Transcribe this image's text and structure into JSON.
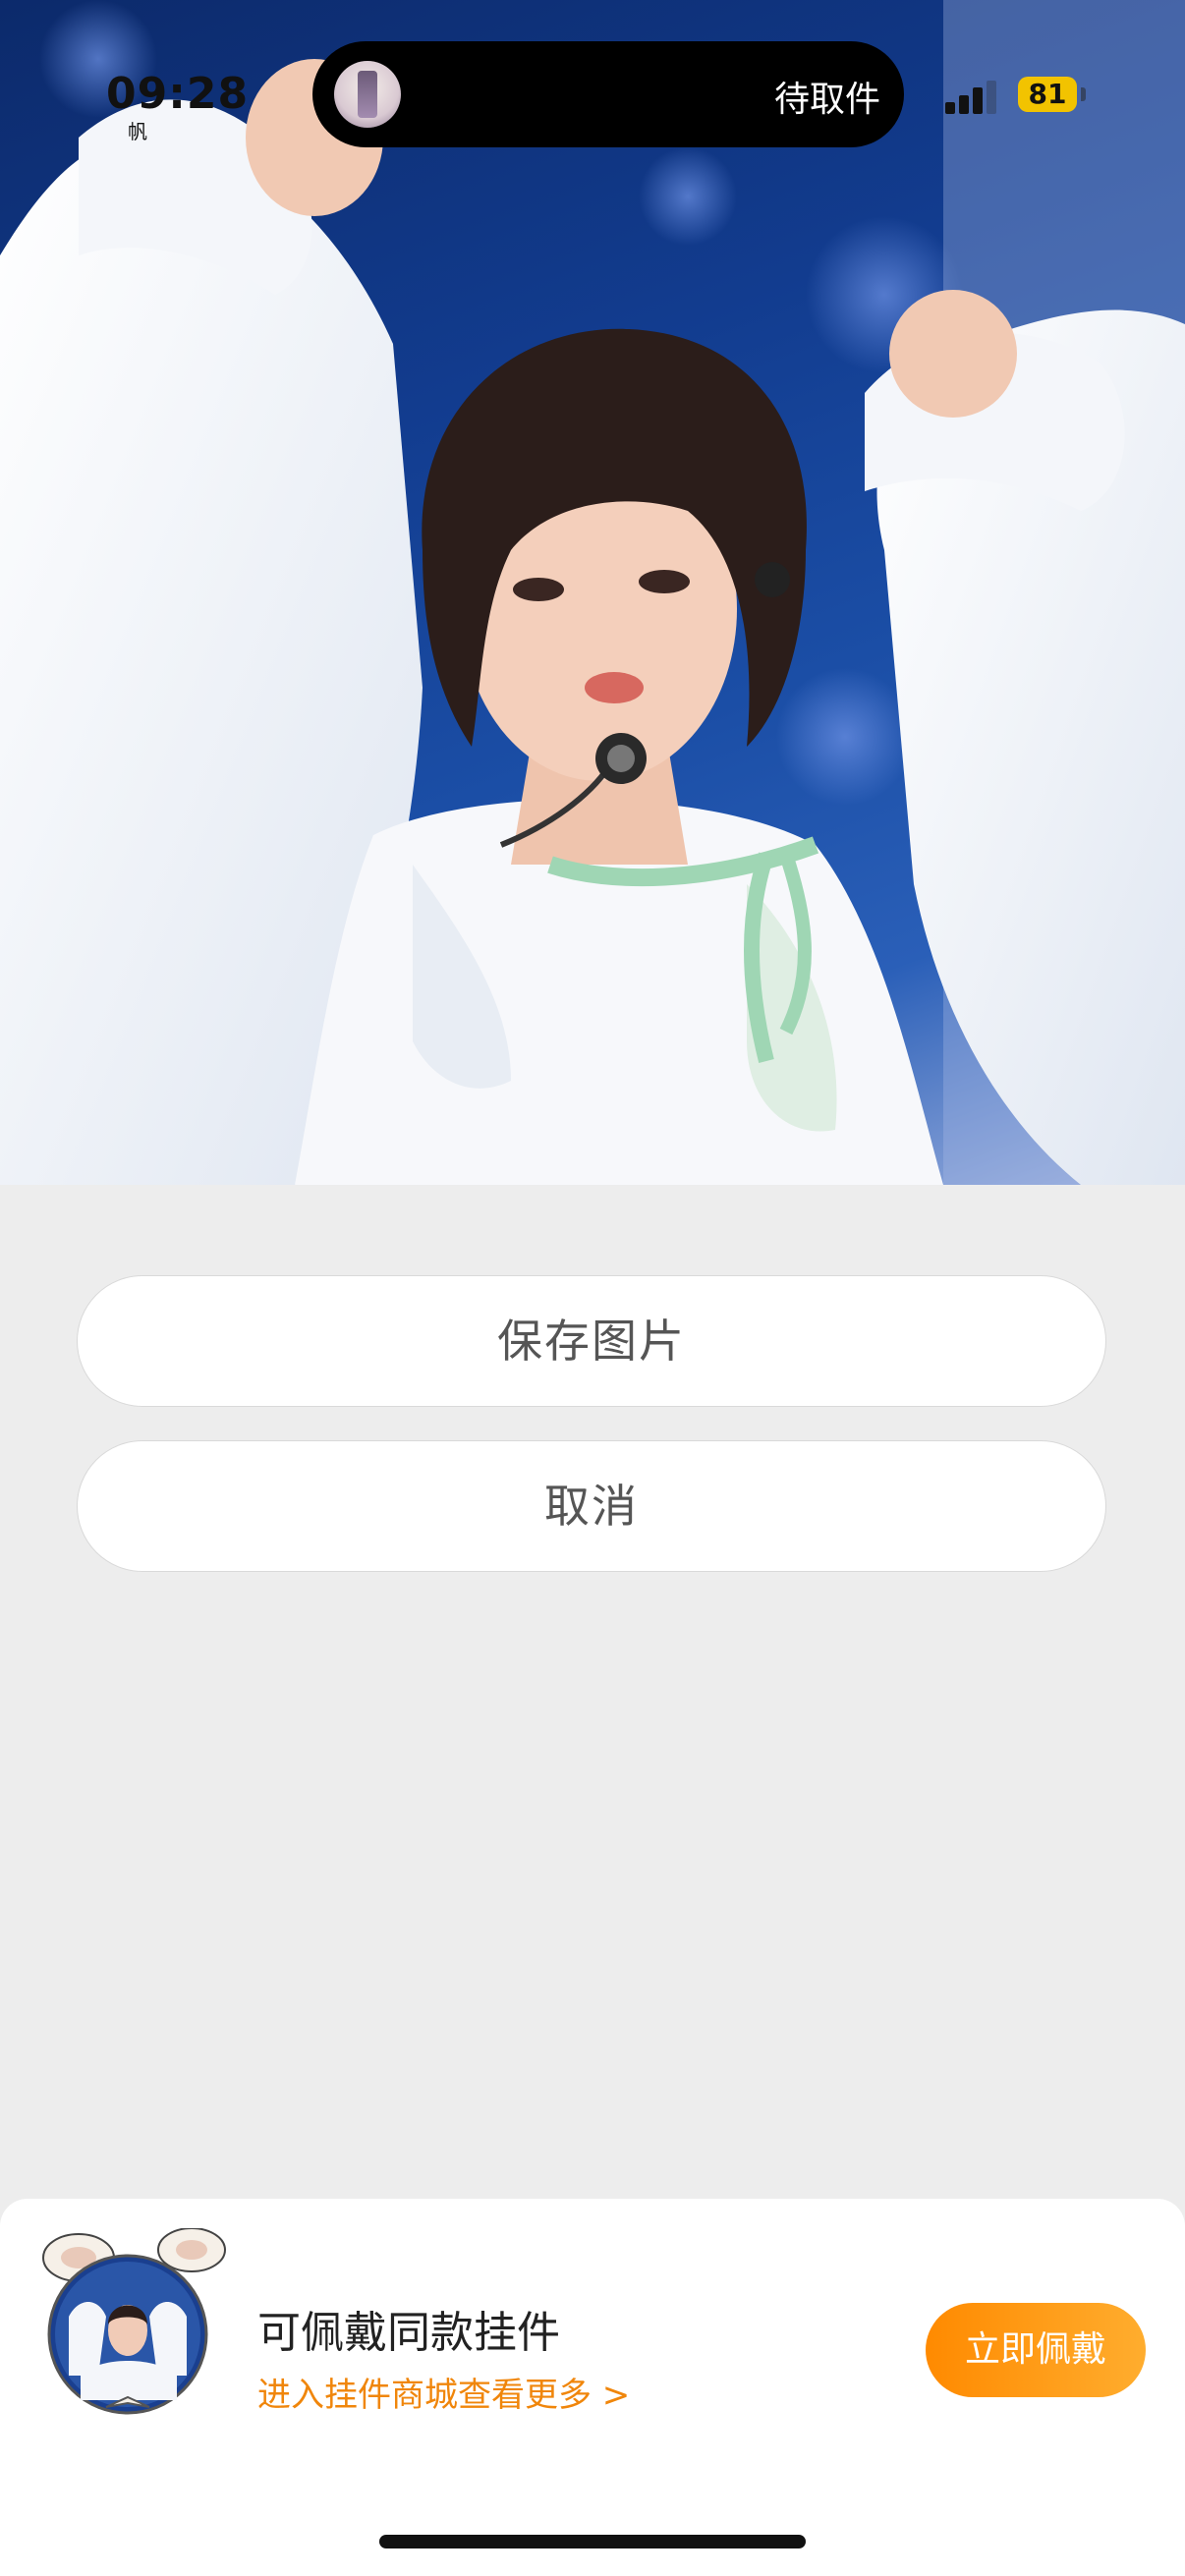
{
  "status_bar": {
    "time": "09:28",
    "time_sub": "帆",
    "live_activity_label": "待取件",
    "battery_level": "81",
    "signal_bars": 3
  },
  "action_sheet": {
    "save_label": "保存图片",
    "cancel_label": "取消"
  },
  "pendant_promo": {
    "title": "可佩戴同款挂件",
    "link_text": "进入挂件商城查看更多 >",
    "wear_button": "立即佩戴"
  },
  "colors": {
    "accent_orange": "#f0860b",
    "battery_yellow": "#f2c300",
    "background": "#ededed"
  }
}
